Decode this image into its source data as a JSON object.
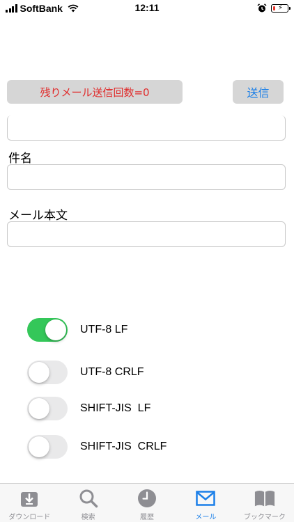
{
  "status_bar": {
    "carrier": "SoftBank",
    "time": "12:11",
    "battery_level": 0.15
  },
  "header": {
    "remaining_label": "残りメール送信回数=0",
    "send_label": "送信"
  },
  "form": {
    "subject_label": "件名",
    "subject_value": "",
    "body_label": "メール本文",
    "body_value": ""
  },
  "encodings": [
    {
      "label": "UTF-8 LF",
      "on": true
    },
    {
      "label": "UTF-8 CRLF",
      "on": false
    },
    {
      "label": "SHIFT-JIS  LF",
      "on": false
    },
    {
      "label": "SHIFT-JIS  CRLF",
      "on": false
    }
  ],
  "tabs": [
    {
      "label": "ダウンロード",
      "icon": "download-icon",
      "active": false
    },
    {
      "label": "検索",
      "icon": "search-icon",
      "active": false
    },
    {
      "label": "履歴",
      "icon": "clock-icon",
      "active": false
    },
    {
      "label": "メール",
      "icon": "mail-icon",
      "active": true
    },
    {
      "label": "ブックマーク",
      "icon": "book-icon",
      "active": false
    }
  ],
  "colors": {
    "accent": "#1a7fe8",
    "warning_text": "#e02a2a",
    "toggle_on": "#34c759",
    "inactive_tab": "#8e8e93"
  }
}
